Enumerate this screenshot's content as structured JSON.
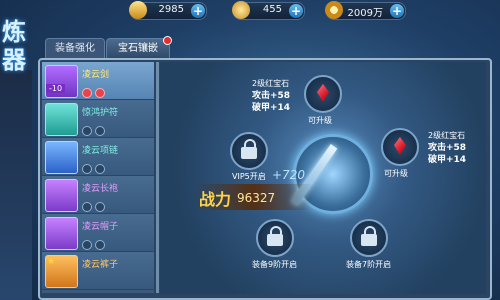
{
  "resources": [
    {
      "icon": "gold-bar-icon",
      "value": "2985"
    },
    {
      "icon": "ingot-icon",
      "value": "455"
    },
    {
      "icon": "coin-icon",
      "value": "2009万"
    }
  ],
  "title": [
    "炼",
    "器"
  ],
  "tabs": [
    {
      "label": "装备强化",
      "selected": false
    },
    {
      "label": "宝石镶嵌",
      "selected": true
    }
  ],
  "equipment": [
    {
      "name": "凌云剑",
      "icon": "sword-icon",
      "badge": "-10",
      "slots": [
        "red",
        "red"
      ],
      "selected": true
    },
    {
      "name": "惊鸿护符",
      "icon": "amulet-icon",
      "slots": [
        "empty",
        "empty"
      ]
    },
    {
      "name": "凌云项链",
      "icon": "necklace-icon",
      "slots": [
        "empty",
        "empty"
      ]
    },
    {
      "name": "凌云长袍",
      "icon": "robe-icon",
      "slots": [
        "empty",
        "empty"
      ]
    },
    {
      "name": "凌云帽子",
      "icon": "hat-icon",
      "slots": [
        "empty",
        "empty"
      ]
    },
    {
      "name": "凌云裤子",
      "icon": "pants-icon",
      "slots": []
    }
  ],
  "sockets": {
    "top": {
      "gem": "2级红宝石",
      "attack": "攻击+58",
      "pierce": "破甲+14",
      "label": "可升级"
    },
    "right": {
      "gem": "2级红宝石",
      "attack": "攻击+58",
      "pierce": "破甲+14",
      "label": "可升级"
    },
    "left_lock": {
      "label": "VIP5开启"
    },
    "bottom_left_lock": {
      "label": "装备9阶开启"
    },
    "bottom_right_lock": {
      "label": "装备7阶开启"
    }
  },
  "power": {
    "label": "战力",
    "value": "96327",
    "gain": "+720"
  }
}
